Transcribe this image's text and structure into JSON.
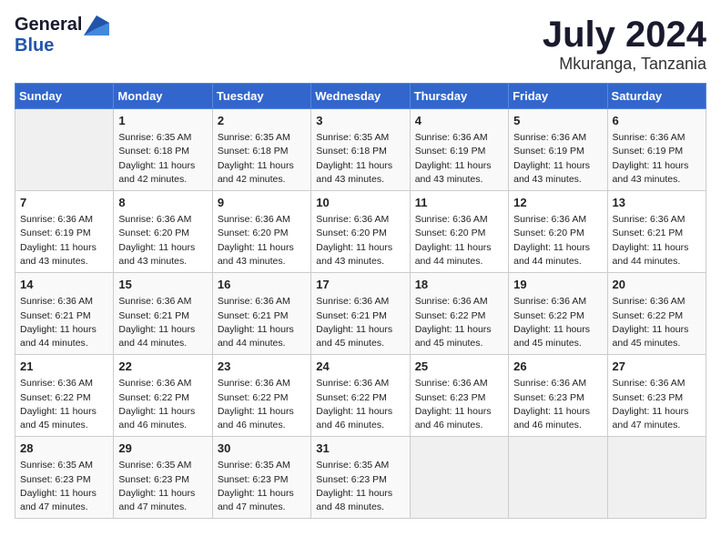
{
  "logo": {
    "general": "General",
    "blue": "Blue"
  },
  "title": "July 2024",
  "location": "Mkuranga, Tanzania",
  "days_of_week": [
    "Sunday",
    "Monday",
    "Tuesday",
    "Wednesday",
    "Thursday",
    "Friday",
    "Saturday"
  ],
  "weeks": [
    [
      {
        "day": "",
        "info": ""
      },
      {
        "day": "1",
        "info": "Sunrise: 6:35 AM\nSunset: 6:18 PM\nDaylight: 11 hours\nand 42 minutes."
      },
      {
        "day": "2",
        "info": "Sunrise: 6:35 AM\nSunset: 6:18 PM\nDaylight: 11 hours\nand 42 minutes."
      },
      {
        "day": "3",
        "info": "Sunrise: 6:35 AM\nSunset: 6:18 PM\nDaylight: 11 hours\nand 43 minutes."
      },
      {
        "day": "4",
        "info": "Sunrise: 6:36 AM\nSunset: 6:19 PM\nDaylight: 11 hours\nand 43 minutes."
      },
      {
        "day": "5",
        "info": "Sunrise: 6:36 AM\nSunset: 6:19 PM\nDaylight: 11 hours\nand 43 minutes."
      },
      {
        "day": "6",
        "info": "Sunrise: 6:36 AM\nSunset: 6:19 PM\nDaylight: 11 hours\nand 43 minutes."
      }
    ],
    [
      {
        "day": "7",
        "info": "Sunrise: 6:36 AM\nSunset: 6:19 PM\nDaylight: 11 hours\nand 43 minutes."
      },
      {
        "day": "8",
        "info": "Sunrise: 6:36 AM\nSunset: 6:20 PM\nDaylight: 11 hours\nand 43 minutes."
      },
      {
        "day": "9",
        "info": "Sunrise: 6:36 AM\nSunset: 6:20 PM\nDaylight: 11 hours\nand 43 minutes."
      },
      {
        "day": "10",
        "info": "Sunrise: 6:36 AM\nSunset: 6:20 PM\nDaylight: 11 hours\nand 43 minutes."
      },
      {
        "day": "11",
        "info": "Sunrise: 6:36 AM\nSunset: 6:20 PM\nDaylight: 11 hours\nand 44 minutes."
      },
      {
        "day": "12",
        "info": "Sunrise: 6:36 AM\nSunset: 6:20 PM\nDaylight: 11 hours\nand 44 minutes."
      },
      {
        "day": "13",
        "info": "Sunrise: 6:36 AM\nSunset: 6:21 PM\nDaylight: 11 hours\nand 44 minutes."
      }
    ],
    [
      {
        "day": "14",
        "info": "Sunrise: 6:36 AM\nSunset: 6:21 PM\nDaylight: 11 hours\nand 44 minutes."
      },
      {
        "day": "15",
        "info": "Sunrise: 6:36 AM\nSunset: 6:21 PM\nDaylight: 11 hours\nand 44 minutes."
      },
      {
        "day": "16",
        "info": "Sunrise: 6:36 AM\nSunset: 6:21 PM\nDaylight: 11 hours\nand 44 minutes."
      },
      {
        "day": "17",
        "info": "Sunrise: 6:36 AM\nSunset: 6:21 PM\nDaylight: 11 hours\nand 45 minutes."
      },
      {
        "day": "18",
        "info": "Sunrise: 6:36 AM\nSunset: 6:22 PM\nDaylight: 11 hours\nand 45 minutes."
      },
      {
        "day": "19",
        "info": "Sunrise: 6:36 AM\nSunset: 6:22 PM\nDaylight: 11 hours\nand 45 minutes."
      },
      {
        "day": "20",
        "info": "Sunrise: 6:36 AM\nSunset: 6:22 PM\nDaylight: 11 hours\nand 45 minutes."
      }
    ],
    [
      {
        "day": "21",
        "info": "Sunrise: 6:36 AM\nSunset: 6:22 PM\nDaylight: 11 hours\nand 45 minutes."
      },
      {
        "day": "22",
        "info": "Sunrise: 6:36 AM\nSunset: 6:22 PM\nDaylight: 11 hours\nand 46 minutes."
      },
      {
        "day": "23",
        "info": "Sunrise: 6:36 AM\nSunset: 6:22 PM\nDaylight: 11 hours\nand 46 minutes."
      },
      {
        "day": "24",
        "info": "Sunrise: 6:36 AM\nSunset: 6:22 PM\nDaylight: 11 hours\nand 46 minutes."
      },
      {
        "day": "25",
        "info": "Sunrise: 6:36 AM\nSunset: 6:23 PM\nDaylight: 11 hours\nand 46 minutes."
      },
      {
        "day": "26",
        "info": "Sunrise: 6:36 AM\nSunset: 6:23 PM\nDaylight: 11 hours\nand 46 minutes."
      },
      {
        "day": "27",
        "info": "Sunrise: 6:36 AM\nSunset: 6:23 PM\nDaylight: 11 hours\nand 47 minutes."
      }
    ],
    [
      {
        "day": "28",
        "info": "Sunrise: 6:35 AM\nSunset: 6:23 PM\nDaylight: 11 hours\nand 47 minutes."
      },
      {
        "day": "29",
        "info": "Sunrise: 6:35 AM\nSunset: 6:23 PM\nDaylight: 11 hours\nand 47 minutes."
      },
      {
        "day": "30",
        "info": "Sunrise: 6:35 AM\nSunset: 6:23 PM\nDaylight: 11 hours\nand 47 minutes."
      },
      {
        "day": "31",
        "info": "Sunrise: 6:35 AM\nSunset: 6:23 PM\nDaylight: 11 hours\nand 48 minutes."
      },
      {
        "day": "",
        "info": ""
      },
      {
        "day": "",
        "info": ""
      },
      {
        "day": "",
        "info": ""
      }
    ]
  ]
}
